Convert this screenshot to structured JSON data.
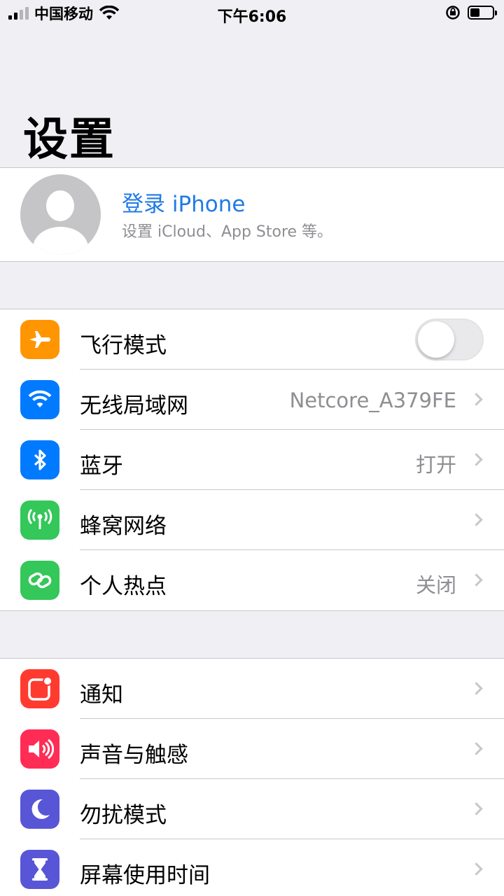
{
  "status_bar": {
    "carrier": "中国移动",
    "time": "下午6:06"
  },
  "title": "设置",
  "profile": {
    "name": "登录 iPhone",
    "subtitle": "设置 iCloud、App Store 等。"
  },
  "group1": [
    {
      "label": "飞行模式",
      "value": "",
      "icon": "airplane-icon",
      "color": "#ff9500",
      "type": "toggle",
      "on": false
    },
    {
      "label": "无线局域网",
      "value": "Netcore_A379FE",
      "icon": "wifi-icon",
      "color": "#007aff",
      "type": "link"
    },
    {
      "label": "蓝牙",
      "value": "打开",
      "icon": "bluetooth-icon",
      "color": "#007aff",
      "type": "link"
    },
    {
      "label": "蜂窝网络",
      "value": "",
      "icon": "cellular-antenna-icon",
      "color": "#34c759",
      "type": "link"
    },
    {
      "label": "个人热点",
      "value": "关闭",
      "icon": "hotspot-link-icon",
      "color": "#34c759",
      "type": "link"
    }
  ],
  "group2": [
    {
      "label": "通知",
      "value": "",
      "icon": "notification-icon",
      "color": "#ff3b30",
      "type": "link"
    },
    {
      "label": "声音与触感",
      "value": "",
      "icon": "speaker-icon",
      "color": "#ff2d55",
      "type": "link"
    },
    {
      "label": "勿扰模式",
      "value": "",
      "icon": "moon-icon",
      "color": "#5856d6",
      "type": "link"
    },
    {
      "label": "屏幕使用时间",
      "value": "",
      "icon": "hourglass-icon",
      "color": "#5856d6",
      "type": "link"
    }
  ]
}
